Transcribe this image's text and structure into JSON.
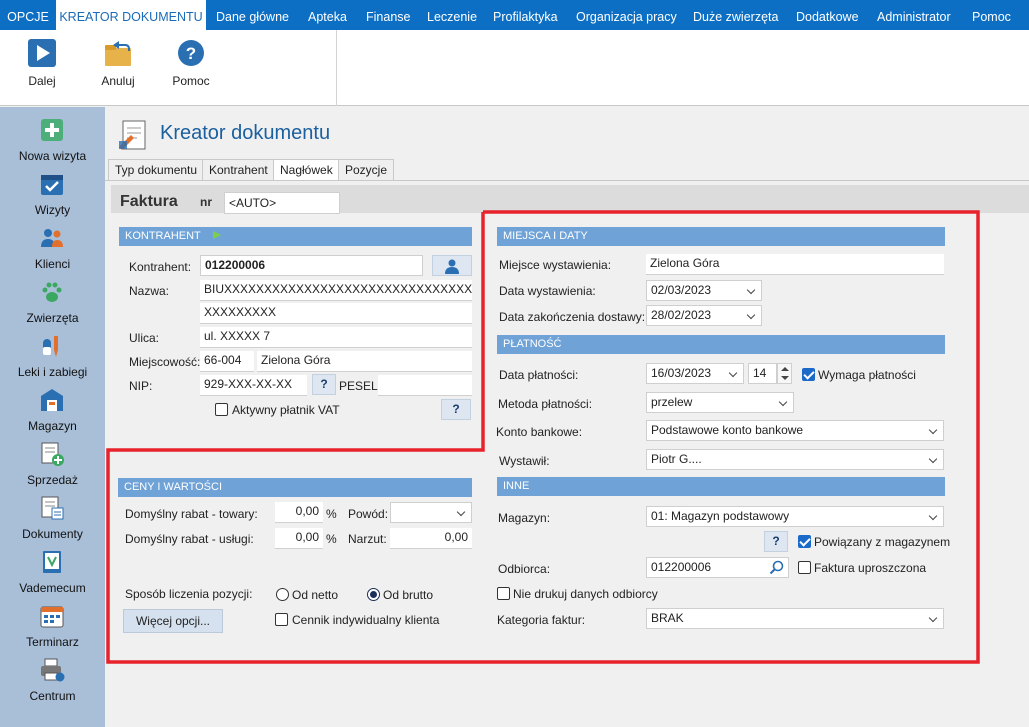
{
  "menu": {
    "items": [
      "OPCJE",
      "KREATOR DOKUMENTU",
      "Dane główne",
      "Apteka",
      "Finanse",
      "Leczenie",
      "Profilaktyka",
      "Organizacja pracy",
      "Duże zwierzęta",
      "Dodatkowe",
      "Administrator",
      "Pomoc"
    ],
    "active_index": 1
  },
  "ribbon": {
    "next": "Dalej",
    "cancel": "Anuluj",
    "help": "Pomoc"
  },
  "sidebar": {
    "items": [
      "Nowa wizyta",
      "Wizyty",
      "Klienci",
      "Zwierzęta",
      "Leki i zabiegi",
      "Magazyn",
      "Sprzedaż",
      "Dokumenty",
      "Vademecum",
      "Terminarz",
      "Centrum"
    ]
  },
  "page": {
    "title": "Kreator dokumentu",
    "tabs": [
      "Typ dokumentu",
      "Kontrahent",
      "Nagłówek",
      "Pozycje"
    ],
    "active_tab": 2,
    "doc_type": "Faktura",
    "nr_label": "nr",
    "nr_value": "<AUTO>"
  },
  "kontrahent": {
    "header": "KONTRAHENT",
    "contractor_label": "Kontrahent:",
    "contractor_value": "012200006",
    "name_label": "Nazwa:",
    "name_line1": "BIUXXXXXXXXXXXXXXXXXXXXXXXXXXXXXXXXXXXXXX",
    "name_line2": "XXXXXXXXX",
    "street_label": "Ulica:",
    "street_value": "ul. XXXXX 7",
    "city_label": "Miejscowość:",
    "postal_value": "66-004",
    "city_value": "Zielona Góra",
    "nip_label": "NIP:",
    "nip_value": "929-XXX-XX-XX",
    "pesel_label": "PESEL:",
    "pesel_value": "",
    "vat_label": "Aktywny płatnik VAT",
    "vat_checked": false,
    "q": "?"
  },
  "ceny": {
    "header": "CENY I WARTOŚCI",
    "rabat_towary_label": "Domyślny rabat - towary:",
    "rabat_towary_value": "0,00",
    "rabat_uslugi_label": "Domyślny rabat - usługi:",
    "rabat_uslugi_value": "0,00",
    "percent": "%",
    "powod_label": "Powód:",
    "powod_value": "",
    "narzut_label": "Narzut:",
    "narzut_value": "0,00",
    "sposob_label": "Sposób liczenia pozycji:",
    "netto_label": "Od netto",
    "brutto_label": "Od brutto",
    "selected": "brutto",
    "more_button": "Więcej opcji...",
    "cennik_label": "Cennik indywidualny klienta",
    "cennik_checked": false
  },
  "miejsca": {
    "header": "MIEJSCA I DATY",
    "place_label": "Miejsce wystawienia:",
    "place_value": "Zielona Góra",
    "issue_label": "Data wystawienia:",
    "issue_value": "02/03/2023",
    "delivery_label": "Data zakończenia dostawy:",
    "delivery_value": "28/02/2023"
  },
  "platnosc": {
    "header": "PŁATNOŚĆ",
    "date_label": "Data płatności:",
    "date_value": "16/03/2023",
    "days_value": "14",
    "requires_label": "Wymaga płatności",
    "requires_checked": true,
    "method_label": "Metoda płatności:",
    "method_value": "przelew",
    "account_label": "Konto bankowe:",
    "account_value": "Podstawowe konto bankowe",
    "issuer_label": "Wystawił:",
    "issuer_value": "Piotr G...."
  },
  "inne": {
    "header": "INNE",
    "magazyn_label": "Magazyn:",
    "magazyn_value": "01: Magazyn podstawowy",
    "linked_label": "Powiązany z magazynem",
    "linked_checked": true,
    "odbiorca_label": "Odbiorca:",
    "odbiorca_value": "012200006",
    "simplified_label": "Faktura uproszczona",
    "simplified_checked": false,
    "no_print_label": "Nie drukuj danych odbiorcy",
    "no_print_checked": false,
    "category_label": "Kategoria faktur:",
    "category_value": "BRAK",
    "q": "?"
  },
  "colors": {
    "menubar": "#0c6fc4",
    "section_header": "#6fa2d6",
    "sidebar": "#a9bfd8",
    "highlight": "#e8222d"
  }
}
